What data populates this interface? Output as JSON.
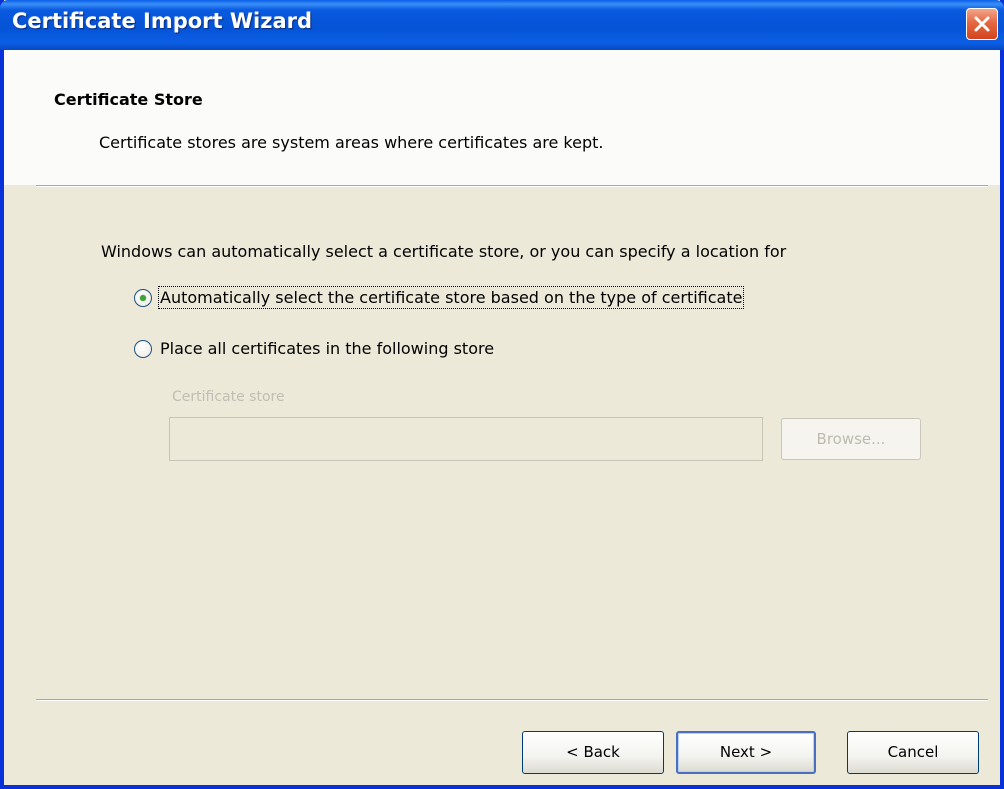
{
  "window": {
    "title": "Certificate Import Wizard"
  },
  "header": {
    "title": "Certificate Store",
    "description": "Certificate stores are system areas where certificates are kept."
  },
  "body": {
    "intro": "Windows can automatically select a certificate store, or you can specify a location for",
    "options": [
      {
        "label": "Automatically select the certificate store based on the type of certificate",
        "checked": true
      },
      {
        "label": "Place all certificates in the following store",
        "checked": false
      }
    ],
    "store_label": "Certificate store",
    "store_value": "",
    "browse_label": "Browse..."
  },
  "footer": {
    "back_label": "< Back",
    "next_label": "Next >",
    "cancel_label": "Cancel"
  },
  "colors": {
    "titlebar": "#0553d6",
    "dialog_bg": "#ece9d8",
    "header_bg": "#fbfbf9",
    "disabled_text": "#c0bdb2"
  },
  "icons": {
    "close": "close-icon"
  }
}
